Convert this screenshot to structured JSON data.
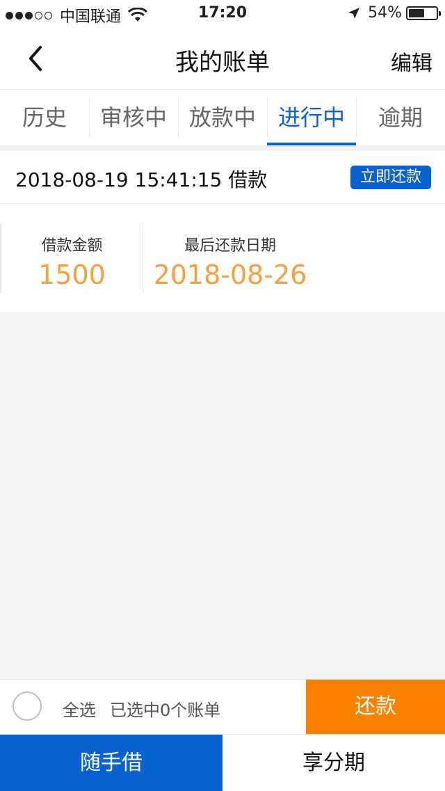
{
  "status_bar": {
    "carrier": "中国联通",
    "time": "17:20",
    "battery": "54%",
    "battery_level": 0.54
  },
  "navbar": {
    "title": "我的账单",
    "edit_label": "编辑"
  },
  "tabs": [
    {
      "label": "历史",
      "active": false
    },
    {
      "label": "审核中",
      "active": false
    },
    {
      "label": "放款中",
      "active": false
    },
    {
      "label": "进行中",
      "active": true
    },
    {
      "label": "逾期",
      "active": false
    }
  ],
  "bill": {
    "datetime_label": "2018-08-19 15:41:15 借款",
    "repay_now_label": "立即还款",
    "amount_label": "借款金额",
    "amount_value": "1500",
    "due_label": "最后还款日期",
    "due_value": "2018-08-26"
  },
  "action_bar": {
    "select_all_label": "全选",
    "selected_info": "已选中0个账单",
    "repay_label": "还款"
  },
  "bottom_tabs": [
    {
      "label": "随手借",
      "active": true
    },
    {
      "label": "享分期",
      "active": false
    }
  ],
  "colors": {
    "primary": "#0a62d0",
    "accent_orange": "#fb8200",
    "amount_orange": "#f5a040"
  }
}
